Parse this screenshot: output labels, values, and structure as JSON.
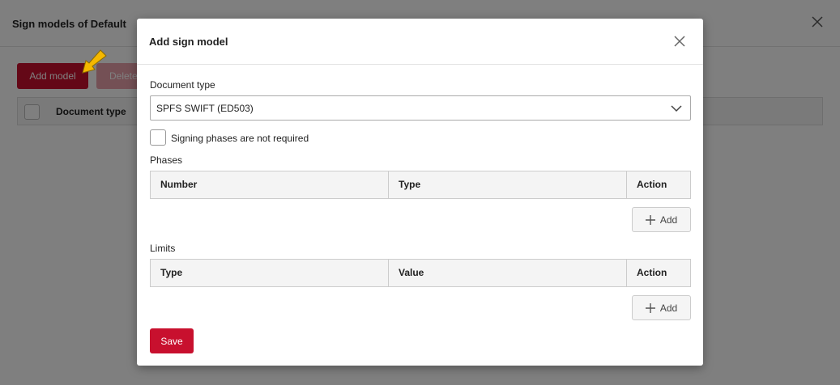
{
  "background": {
    "title": "Sign models of Default",
    "add_model_label": "Add model",
    "delete_label": "Delete",
    "table_column": "Document type"
  },
  "modal": {
    "title": "Add sign model",
    "document_type_label": "Document type",
    "document_type_value": "SPFS SWIFT (ED503)",
    "signing_not_required_label": "Signing phases are not required",
    "phases": {
      "label": "Phases",
      "columns": [
        "Number",
        "Type",
        "Action"
      ],
      "add_label": "Add"
    },
    "limits": {
      "label": "Limits",
      "columns": [
        "Type",
        "Value",
        "Action"
      ],
      "add_label": "Add"
    },
    "save_label": "Save"
  },
  "colors": {
    "accent": "#c8102e",
    "annotation_arrow": "#f5b800"
  },
  "icons": {
    "close": "close-icon",
    "chevron": "chevron-down-icon",
    "plus": "plus-icon",
    "arrow": "pointer-arrow-icon"
  }
}
